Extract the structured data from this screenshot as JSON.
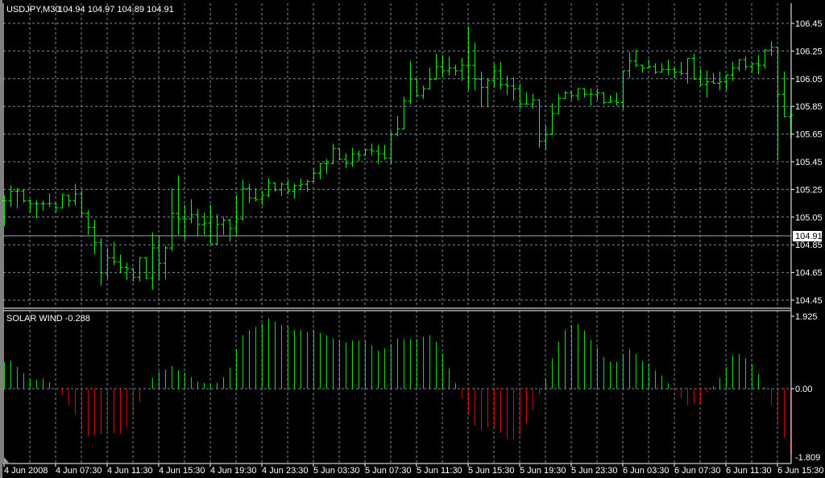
{
  "header": {
    "symbol": "USDJPY,M30",
    "ohlc_text": "104.94 104.97 104.89 104.91"
  },
  "indicator": {
    "label": "SOLAR WIND -0.288",
    "max_label": "1.925",
    "zero_label": "0.00",
    "min_label": "-1.809"
  },
  "current_price": "104.91",
  "colors": {
    "background": "#000000",
    "grid": "#778899",
    "bars": "#00ff00",
    "hist_up": "#00e000",
    "hist_down": "#e00000",
    "axis": "#ffffff"
  },
  "chart_data": [
    {
      "type": "ohlc",
      "title": "USDJPY,M30",
      "ylim": [
        104.45,
        106.45
      ],
      "grid": true,
      "y_ticks": [
        "106.45",
        "106.25",
        "106.05",
        "105.85",
        "105.65",
        "105.45",
        "105.25",
        "105.05",
        "104.85",
        "104.65",
        "104.45"
      ],
      "x_ticks": [
        "4 Jun 2008",
        "4 Jun 07:30",
        "4 Jun 11:30",
        "4 Jun 15:30",
        "4 Jun 19:30",
        "4 Jun 23:30",
        "5 Jun 03:30",
        "5 Jun 07:30",
        "5 Jun 11:30",
        "5 Jun 15:30",
        "5 Jun 19:30",
        "5 Jun 23:30",
        "6 Jun 03:30",
        "6 Jun 07:30",
        "6 Jun 11:30",
        "6 Jun 15:30"
      ],
      "open": [
        105.17,
        105.17,
        105.24,
        105.24,
        105.17,
        105.15,
        105.15,
        105.15,
        105.15,
        105.12,
        105.21,
        105.17,
        105.22,
        105.08,
        104.98,
        104.87,
        104.65,
        104.76,
        104.73,
        104.69,
        104.68,
        104.62,
        104.76,
        104.61,
        104.83,
        104.72,
        104.83,
        105.08,
        105.04,
        105.04,
        105.07,
        105.0,
        105.01,
        104.86,
        105.0,
        105.03,
        104.97,
        105.04,
        105.26,
        105.19,
        105.18,
        105.21,
        105.3,
        105.25,
        105.29,
        105.24,
        105.28,
        105.29,
        105.31,
        105.37,
        105.44,
        105.44,
        105.55,
        105.47,
        105.44,
        105.51,
        105.5,
        105.54,
        105.53,
        105.51,
        105.48,
        105.65,
        105.69,
        105.89,
        106.05,
        105.93,
        105.98,
        106.05,
        106.14,
        106.11,
        106.13,
        106.11,
        106.15,
        106.15,
        106.05,
        105.99,
        106.04,
        106.11,
        106.01,
        106.0,
        105.98,
        105.87,
        105.87,
        105.9,
        105.6,
        105.65,
        105.8,
        105.91,
        105.95,
        105.93,
        105.98,
        105.94,
        105.94,
        105.95,
        105.88,
        105.89,
        105.88,
        106.11,
        106.18,
        106.15,
        106.13,
        106.14,
        106.1,
        106.12,
        106.12,
        106.1,
        106.09,
        106.2,
        106.05,
        106.01,
        106.03,
        106.02,
        106.03,
        106.08,
        106.13,
        106.19,
        106.14,
        106.16,
        106.15,
        106.26,
        106.28,
        105.94,
        105.78
      ],
      "high": [
        105.21,
        105.28,
        105.26,
        105.25,
        105.18,
        105.17,
        105.17,
        105.22,
        105.15,
        105.22,
        105.21,
        105.29,
        105.24,
        105.1,
        105.03,
        104.9,
        104.83,
        104.87,
        104.78,
        104.72,
        104.68,
        104.76,
        104.76,
        104.94,
        104.91,
        104.84,
        105.26,
        105.35,
        105.14,
        105.18,
        105.11,
        105.08,
        105.14,
        105.07,
        105.05,
        105.04,
        105.21,
        105.32,
        105.29,
        105.26,
        105.24,
        105.33,
        105.3,
        105.3,
        105.32,
        105.29,
        105.33,
        105.32,
        105.4,
        105.44,
        105.47,
        105.58,
        105.55,
        105.51,
        105.55,
        105.53,
        105.54,
        105.58,
        105.57,
        105.57,
        105.67,
        105.78,
        105.92,
        106.18,
        106.05,
        106.0,
        106.13,
        106.23,
        106.22,
        106.21,
        106.15,
        106.2,
        106.43,
        106.31,
        106.1,
        106.05,
        106.16,
        106.17,
        106.07,
        106.06,
        106.01,
        105.95,
        105.94,
        105.89,
        105.71,
        105.87,
        105.94,
        105.96,
        105.96,
        105.98,
        105.98,
        105.98,
        105.98,
        105.94,
        105.93,
        105.95,
        106.11,
        106.24,
        106.26,
        106.15,
        106.19,
        106.16,
        106.16,
        106.19,
        106.13,
        106.17,
        106.2,
        106.23,
        106.12,
        106.11,
        106.09,
        106.1,
        106.08,
        106.17,
        106.19,
        106.21,
        106.16,
        106.22,
        106.26,
        106.32,
        106.28,
        106.1,
        105.85
      ],
      "low": [
        104.99,
        105.13,
        105.12,
        105.16,
        105.09,
        105.05,
        105.1,
        105.13,
        105.09,
        105.12,
        105.13,
        105.14,
        105.06,
        104.93,
        104.79,
        104.56,
        104.61,
        104.71,
        104.65,
        104.6,
        104.59,
        104.59,
        104.61,
        104.53,
        104.6,
        104.61,
        104.81,
        104.93,
        104.89,
        105.01,
        104.92,
        104.93,
        104.86,
        104.86,
        104.93,
        104.88,
        104.92,
        105.03,
        105.16,
        105.17,
        105.14,
        105.2,
        105.24,
        105.21,
        105.22,
        105.19,
        105.25,
        105.24,
        105.31,
        105.33,
        105.37,
        105.44,
        105.47,
        105.41,
        105.42,
        105.46,
        105.5,
        105.5,
        105.44,
        105.47,
        105.44,
        105.64,
        105.69,
        105.87,
        105.93,
        105.91,
        105.98,
        106.05,
        106.07,
        106.08,
        106.08,
        106.04,
        105.97,
        105.97,
        105.85,
        105.85,
        105.99,
        105.98,
        105.94,
        105.9,
        105.84,
        105.87,
        105.84,
        105.56,
        105.54,
        105.65,
        105.8,
        105.91,
        105.9,
        105.9,
        105.92,
        105.86,
        105.9,
        105.87,
        105.88,
        105.86,
        105.83,
        106.06,
        106.14,
        106.1,
        106.14,
        106.09,
        106.1,
        106.08,
        106.06,
        106.08,
        106.02,
        106.05,
        106.0,
        105.92,
        106.02,
        105.97,
        105.97,
        106.04,
        106.11,
        106.12,
        106.1,
        106.09,
        106.13,
        106.22,
        105.47,
        105.78,
        105.62
      ],
      "close": [
        105.17,
        105.24,
        105.24,
        105.17,
        105.15,
        105.15,
        105.15,
        105.15,
        105.12,
        105.21,
        105.17,
        105.22,
        105.08,
        104.98,
        104.87,
        104.65,
        104.76,
        104.73,
        104.69,
        104.68,
        104.62,
        104.76,
        104.61,
        104.83,
        104.72,
        104.83,
        105.08,
        105.04,
        105.04,
        105.07,
        105.0,
        105.01,
        104.86,
        105.0,
        105.03,
        104.97,
        105.04,
        105.26,
        105.19,
        105.18,
        105.21,
        105.3,
        105.25,
        105.29,
        105.24,
        105.28,
        105.29,
        105.31,
        105.37,
        105.44,
        105.44,
        105.55,
        105.47,
        105.44,
        105.51,
        105.5,
        105.54,
        105.53,
        105.51,
        105.48,
        105.65,
        105.69,
        105.89,
        106.05,
        105.93,
        105.98,
        106.05,
        106.14,
        106.11,
        106.13,
        106.11,
        106.15,
        106.15,
        106.05,
        105.99,
        106.04,
        106.11,
        106.01,
        106.0,
        105.98,
        105.87,
        105.87,
        105.9,
        105.6,
        105.65,
        105.8,
        105.91,
        105.95,
        105.93,
        105.98,
        105.94,
        105.94,
        105.95,
        105.88,
        105.89,
        105.88,
        106.11,
        106.18,
        106.15,
        106.13,
        106.14,
        106.1,
        106.12,
        106.12,
        106.1,
        106.09,
        106.2,
        106.05,
        106.01,
        106.03,
        106.02,
        106.03,
        106.08,
        106.13,
        106.19,
        106.14,
        106.16,
        106.15,
        106.26,
        106.28,
        105.94,
        105.78,
        105.79
      ]
    },
    {
      "type": "bar",
      "title": "SOLAR WIND -0.288",
      "ylim": [
        -1.809,
        1.925
      ],
      "y_ticks": [
        "1.925",
        "0.00",
        "-1.809"
      ],
      "values": [
        0.7,
        0.75,
        0.58,
        0.41,
        0.26,
        0.24,
        0.26,
        0.17,
        0.0,
        -0.17,
        -0.43,
        -0.68,
        -1.09,
        -1.26,
        -1.24,
        -1.22,
        -1.19,
        -1.17,
        -1.19,
        -1.02,
        -0.7,
        -0.34,
        0.0,
        0.28,
        0.45,
        0.51,
        0.6,
        0.49,
        0.43,
        0.3,
        0.19,
        0.15,
        0.13,
        0.15,
        0.3,
        0.55,
        1.05,
        1.41,
        1.56,
        1.63,
        1.73,
        1.86,
        1.78,
        1.69,
        1.66,
        1.56,
        1.56,
        1.5,
        1.56,
        1.48,
        1.41,
        1.33,
        1.29,
        1.22,
        1.27,
        1.27,
        1.27,
        1.14,
        1.01,
        1.07,
        1.18,
        1.33,
        1.31,
        1.31,
        1.31,
        1.37,
        1.41,
        1.24,
        0.92,
        0.54,
        0.14,
        -0.26,
        -0.67,
        -0.97,
        -1.09,
        -1.03,
        -1.01,
        -1.16,
        -1.33,
        -1.33,
        -1.22,
        -0.92,
        -0.56,
        -0.14,
        0.27,
        0.8,
        1.24,
        1.56,
        1.69,
        1.71,
        1.54,
        1.29,
        1.09,
        0.84,
        0.71,
        0.71,
        0.92,
        1.05,
        0.92,
        0.73,
        0.67,
        0.48,
        0.35,
        0.14,
        -0.05,
        -0.25,
        -0.43,
        -0.39,
        -0.41,
        -0.11,
        0.07,
        0.28,
        0.58,
        0.88,
        0.92,
        0.8,
        0.65,
        0.39,
        0.03,
        -0.43,
        -0.97,
        -1.31,
        -1.75
      ]
    }
  ]
}
